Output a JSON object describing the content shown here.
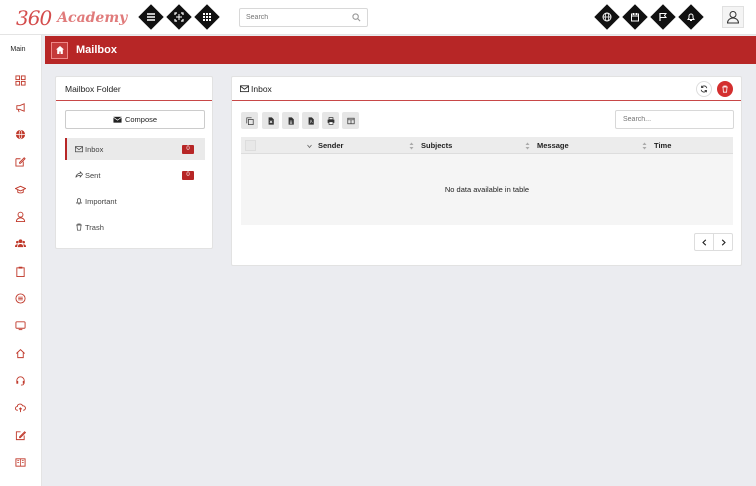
{
  "brand": {
    "logo_number": "360",
    "logo_text": "Academy"
  },
  "topbar": {
    "search_placeholder": "Search",
    "left_icons": [
      "menu-icon",
      "fullscreen-icon",
      "apps-grid-icon"
    ],
    "right_icons": [
      "globe-icon",
      "calendar-icon",
      "flag-icon",
      "bell-icon"
    ]
  },
  "sidebar": {
    "title": "Main",
    "icons": [
      "dashboard-icon",
      "megaphone-icon",
      "globe-icon",
      "edit-icon",
      "graduation-cap-icon",
      "user-icon",
      "users-icon",
      "clipboard-icon",
      "subscription-icon",
      "monitor-icon",
      "home-icon",
      "headset-icon",
      "cloud-upload-icon",
      "pen-square-icon",
      "book-icon"
    ]
  },
  "header": {
    "title": "Mailbox"
  },
  "mailbox_folder": {
    "title": "Mailbox Folder",
    "compose_label": "Compose",
    "items": [
      {
        "label": "Inbox",
        "count": "0",
        "icon": "envelope-icon",
        "active": true
      },
      {
        "label": "Sent",
        "count": "0",
        "icon": "share-icon",
        "active": false
      },
      {
        "label": "Important",
        "count": null,
        "icon": "bell-icon",
        "active": false
      },
      {
        "label": "Trash",
        "count": null,
        "icon": "trash-icon",
        "active": false
      }
    ]
  },
  "inbox": {
    "title": "Inbox",
    "search_placeholder": "Search...",
    "toolbar_icons": [
      "copy-icon",
      "excel-icon",
      "csv-icon",
      "pdf-icon",
      "print-icon",
      "columns-icon"
    ],
    "columns": [
      "Sender",
      "Subjects",
      "Message",
      "Time"
    ],
    "empty_text": "No data available in table"
  },
  "colors": {
    "brand_red": "#b72626",
    "badge_red": "#b72626",
    "delete_red": "#d32f2f"
  }
}
